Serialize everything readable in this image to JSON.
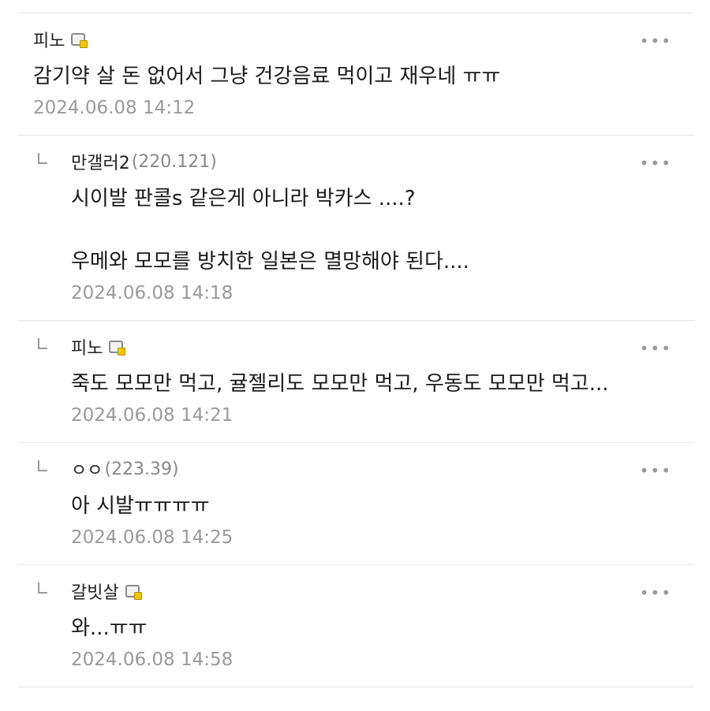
{
  "comments": [
    {
      "author": "피노",
      "ip": "",
      "member": true,
      "reply": false,
      "text": "감기약 살 돈 없어서 그냥 건강음료 먹이고 재우네 ㅠㅠ",
      "time": "2024.06.08 14:12"
    },
    {
      "author": "만갤러2",
      "ip": "(220.121)",
      "member": false,
      "reply": true,
      "text": "시이발 판콜s 같은게 아니라 박카스 ....?\n\n우메와 모모를 방치한 일본은 멸망해야 된다....",
      "time": "2024.06.08 14:18"
    },
    {
      "author": "피노",
      "ip": "",
      "member": true,
      "reply": true,
      "text": "죽도 모모만 먹고, 귤젤리도 모모만 먹고, 우동도 모모만 먹고...",
      "time": "2024.06.08 14:21"
    },
    {
      "author": "ㅇㅇ",
      "ip": "(223.39)",
      "member": false,
      "reply": true,
      "text": "아 시발ㅠㅠㅠㅠ",
      "time": "2024.06.08 14:25"
    },
    {
      "author": "갈빗살",
      "ip": "",
      "member": true,
      "reply": true,
      "text": "와...ㅠㅠ",
      "time": "2024.06.08 14:58"
    }
  ],
  "more_label": "•••",
  "icons": {
    "more": "more-options-icon",
    "member": "member-badge-icon",
    "reply": "reply-arrow-icon"
  }
}
